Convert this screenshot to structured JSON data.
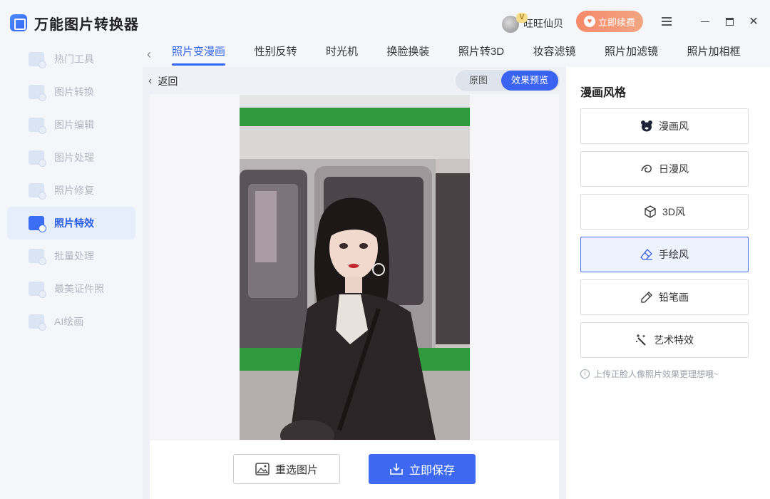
{
  "app": {
    "name": "万能图片转换器"
  },
  "sidebar": {
    "items": [
      {
        "label": "热门工具",
        "icon": "hot-tools-icon",
        "active": false
      },
      {
        "label": "图片转换",
        "icon": "image-convert-icon",
        "active": false
      },
      {
        "label": "图片编辑",
        "icon": "image-edit-icon",
        "active": false
      },
      {
        "label": "图片处理",
        "icon": "image-process-icon",
        "active": false
      },
      {
        "label": "照片修复",
        "icon": "photo-repair-icon",
        "active": false
      },
      {
        "label": "照片特效",
        "icon": "photo-effects-icon",
        "active": true
      },
      {
        "label": "批量处理",
        "icon": "batch-process-icon",
        "active": false
      },
      {
        "label": "最美证件照",
        "icon": "id-photo-icon",
        "active": false
      },
      {
        "label": "AI绘画",
        "icon": "ai-painting-icon",
        "active": false
      }
    ]
  },
  "header": {
    "user_name": "旺旺仙贝",
    "vip_badge": "V",
    "renew_label": "立即续费",
    "accent_color": "#f58a6a"
  },
  "tabs": [
    {
      "label": "照片变漫画",
      "active": true
    },
    {
      "label": "性别反转",
      "active": false
    },
    {
      "label": "时光机",
      "active": false
    },
    {
      "label": "换脸换装",
      "active": false
    },
    {
      "label": "照片转3D",
      "active": false
    },
    {
      "label": "妆容滤镜",
      "active": false
    },
    {
      "label": "照片加滤镜",
      "active": false
    },
    {
      "label": "照片加相框",
      "active": false
    }
  ],
  "preview": {
    "back_label": "返回",
    "toggle_original": "原图",
    "toggle_effect": "效果预览",
    "reselect_label": "重选图片",
    "save_label": "立即保存",
    "primary_color": "#3f68f0"
  },
  "styles_panel": {
    "title": "漫画风格",
    "options": [
      {
        "label": "漫画风",
        "icon": "bear-icon",
        "selected": false
      },
      {
        "label": "日漫风",
        "icon": "swirl-icon",
        "selected": false
      },
      {
        "label": "3D风",
        "icon": "cube-icon",
        "selected": false
      },
      {
        "label": "手绘风",
        "icon": "eraser-icon",
        "selected": true
      },
      {
        "label": "铅笔画",
        "icon": "pencil-icon",
        "selected": false
      },
      {
        "label": "艺术特效",
        "icon": "magic-wand-icon",
        "selected": false
      }
    ],
    "hint": "上传正脸人像照片效果更理想哦~"
  }
}
